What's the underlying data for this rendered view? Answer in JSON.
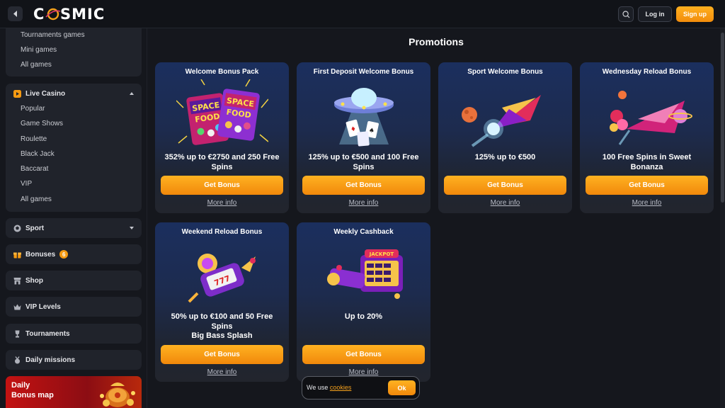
{
  "header": {
    "logo_text": "COSMIC",
    "login_label": "Log in",
    "signup_label": "Sign up"
  },
  "sidebar": {
    "games_sub": [
      "Tournaments games",
      "Mini games",
      "All games"
    ],
    "live_casino": {
      "label": "Live Casino",
      "items": [
        "Popular",
        "Game Shows",
        "Roulette",
        "Black Jack",
        "Baccarat",
        "VIP",
        "All games"
      ]
    },
    "sport_label": "Sport",
    "bonuses_label": "Bonuses",
    "bonuses_count": "6",
    "shop_label": "Shop",
    "vip_label": "VIP Levels",
    "tournaments_label": "Tournaments",
    "missions_label": "Daily missions",
    "daily_banner": {
      "line1": "Daily",
      "line2": "Bonus map"
    }
  },
  "main": {
    "title": "Promotions",
    "cards": [
      {
        "title": "Welcome Bonus Pack",
        "offer": "352% up to €2750 and 250 Free Spins",
        "button": "Get Bonus",
        "more": "More info"
      },
      {
        "title": "First Deposit Welcome Bonus",
        "offer": "125% up to €500 and 100 Free Spins",
        "button": "Get Bonus",
        "more": "More info"
      },
      {
        "title": "Sport Welcome Bonus",
        "offer": "125% up to €500",
        "button": "Get Bonus",
        "more": "More info"
      },
      {
        "title": "Wednesday Reload Bonus",
        "offer": "100 Free Spins in Sweet Bonanza",
        "button": "Get Bonus",
        "more": "More info"
      },
      {
        "title": "Weekend Reload Bonus",
        "offer": "50% up to €100 and 50 Free Spins",
        "offer2": "Big Bass Splash",
        "button": "Get Bonus",
        "more": "More info"
      },
      {
        "title": "Weekly Cashback",
        "offer": "Up to 20%",
        "button": "Get Bonus",
        "more": "More info"
      }
    ]
  },
  "cookie": {
    "text": "We use",
    "link": "cookies",
    "ok": "Ok"
  },
  "colors": {
    "accent": "#f7a21b",
    "background": "#15171d",
    "panel": "#20232b"
  }
}
